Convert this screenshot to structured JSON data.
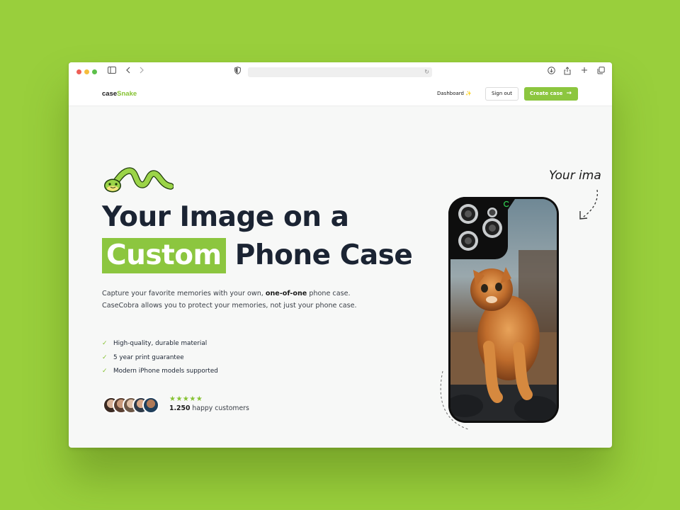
{
  "browser": {
    "address_value": ""
  },
  "nav": {
    "brand_part1": "case",
    "brand_part2": "Snake",
    "dashboard_label": "Dashboard ✨",
    "signout_label": "Sign out",
    "create_label": "Create case",
    "create_arrow": "→"
  },
  "hero": {
    "headline_line1": "Your Image on a",
    "headline_highlight": "Custom",
    "headline_line2_rest": " Phone Case",
    "description_part1": "Capture your favorite memories with your own, ",
    "description_bold": "one-of-one",
    "description_part2": " phone case. CaseCobra allows you to protect your memories, not just your phone case.",
    "features": [
      "High-quality, durable material",
      "5 year print guarantee",
      "Modern iPhone models supported"
    ],
    "rating_stars": "★★★★★",
    "customers_count": "1.250",
    "customers_label": " happy customers"
  },
  "annotation": "Your ima",
  "colors": {
    "accent": "#8cc63f",
    "page_background": "#99cf3c",
    "heading": "#1b2433"
  },
  "icons": {
    "check": "check-icon",
    "star": "star-icon"
  }
}
